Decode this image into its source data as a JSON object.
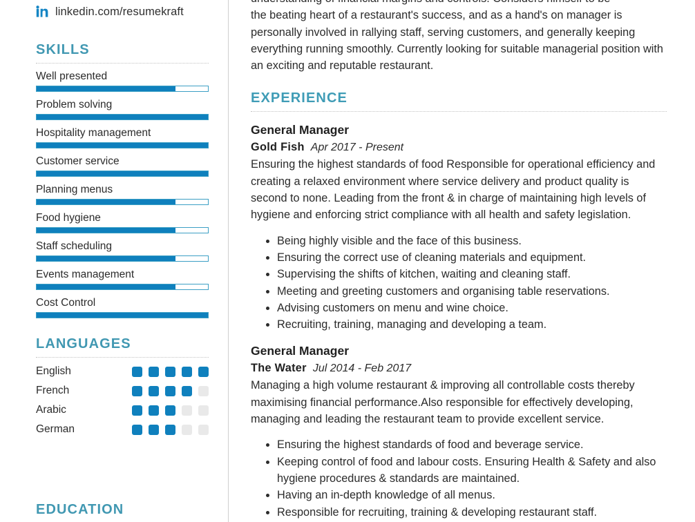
{
  "contact": {
    "icon": "linkedin-icon",
    "linkedin": "linkedin.com/resumekraft"
  },
  "colors": {
    "accent_bar": "#0f80bd",
    "heading": "#4198b2",
    "dot_off": "#e9e9e9",
    "divider": "#cfcfcf"
  },
  "sidebar": {
    "skills_heading": "SKILLS",
    "skills": [
      {
        "name": "Well presented",
        "level": 81
      },
      {
        "name": "Problem solving",
        "level": 100
      },
      {
        "name": "Hospitality management",
        "level": 100
      },
      {
        "name": "Customer service",
        "level": 100
      },
      {
        "name": "Planning menus",
        "level": 81
      },
      {
        "name": "Food hygiene",
        "level": 81
      },
      {
        "name": "Staff scheduling",
        "level": 81
      },
      {
        "name": "Events management",
        "level": 81
      },
      {
        "name": "Cost Control",
        "level": 100
      }
    ],
    "languages_heading": "LANGUAGES",
    "languages": [
      {
        "name": "English",
        "level": 5,
        "max": 5
      },
      {
        "name": "French",
        "level": 4,
        "max": 5
      },
      {
        "name": "Arabic",
        "level": 3,
        "max": 5
      },
      {
        "name": "German",
        "level": 3,
        "max": 5
      }
    ],
    "education_heading": "EDUCATION"
  },
  "main": {
    "summary_partial_line": "understanding of financial margins and controls. Considers himself to be",
    "summary": "the beating heart of a restaurant's success, and as a hand's on manager is personally involved in rallying staff, serving customers, and generally keeping everything running smoothly. Currently looking for suitable managerial position with an exciting and reputable restaurant.",
    "experience_heading": "EXPERIENCE",
    "jobs": [
      {
        "title": "General Manager",
        "company": "Gold Fish",
        "dates": "Apr 2017 - Present",
        "description": "Ensuring the highest standards of food Responsible for operational efficiency and creating a relaxed environment where service delivery and product quality is second to none. Leading from the front & in charge of maintaining high levels of hygiene and enforcing strict compliance with all health and safety legislation.",
        "bullets": [
          "Being highly visible and the face of this business.",
          "Ensuring the correct use of cleaning materials and equipment.",
          "Supervising the shifts of kitchen, waiting and cleaning staff.",
          "Meeting and greeting customers and organising table reservations.",
          "Advising customers on menu and wine choice.",
          "Recruiting, training, managing and developing a team."
        ]
      },
      {
        "title": "General Manager",
        "company": "The Water",
        "dates": "Jul 2014 - Feb 2017",
        "description": "Managing a high volume restaurant & improving all controllable costs thereby maximising financial performance.Also responsible for effectively developing, managing and leading the restaurant team to provide excellent service.",
        "bullets": [
          "Ensuring the highest standards of food and beverage service.",
          "Keeping control of food and labour costs. Ensuring Health & Safety and also hygiene procedures & standards are maintained.",
          "Having an in-depth knowledge of all menus.",
          "Responsible for recruiting, training & developing restaurant staff."
        ]
      }
    ]
  }
}
